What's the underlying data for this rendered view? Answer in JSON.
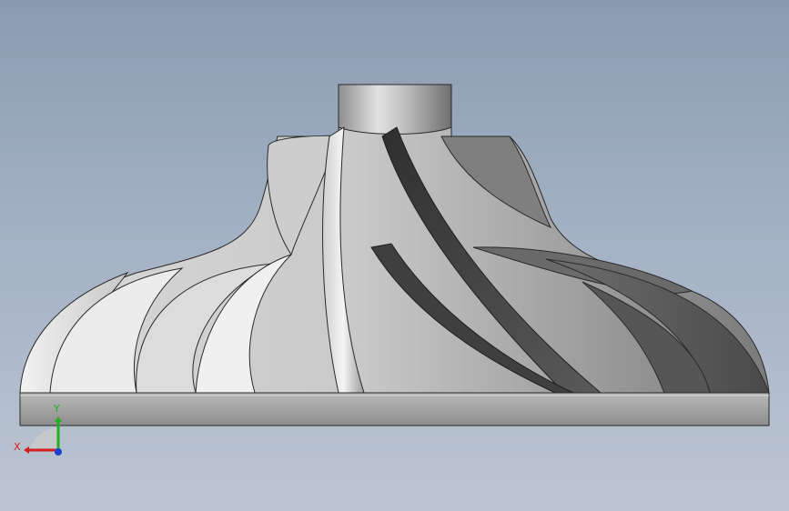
{
  "viewport": {
    "background_top": "#8a9cb2",
    "background_bottom": "#bcc5d3"
  },
  "model": {
    "name": "impeller",
    "base_color": "#a7a7a7",
    "blade_highlight": "#ebebeb",
    "blade_shadow": "#3c3c3c"
  },
  "triad": {
    "x_label": "X",
    "y_label": "Y",
    "x_color": "#d42020",
    "y_color": "#20b020",
    "z_color": "#2040d0"
  }
}
